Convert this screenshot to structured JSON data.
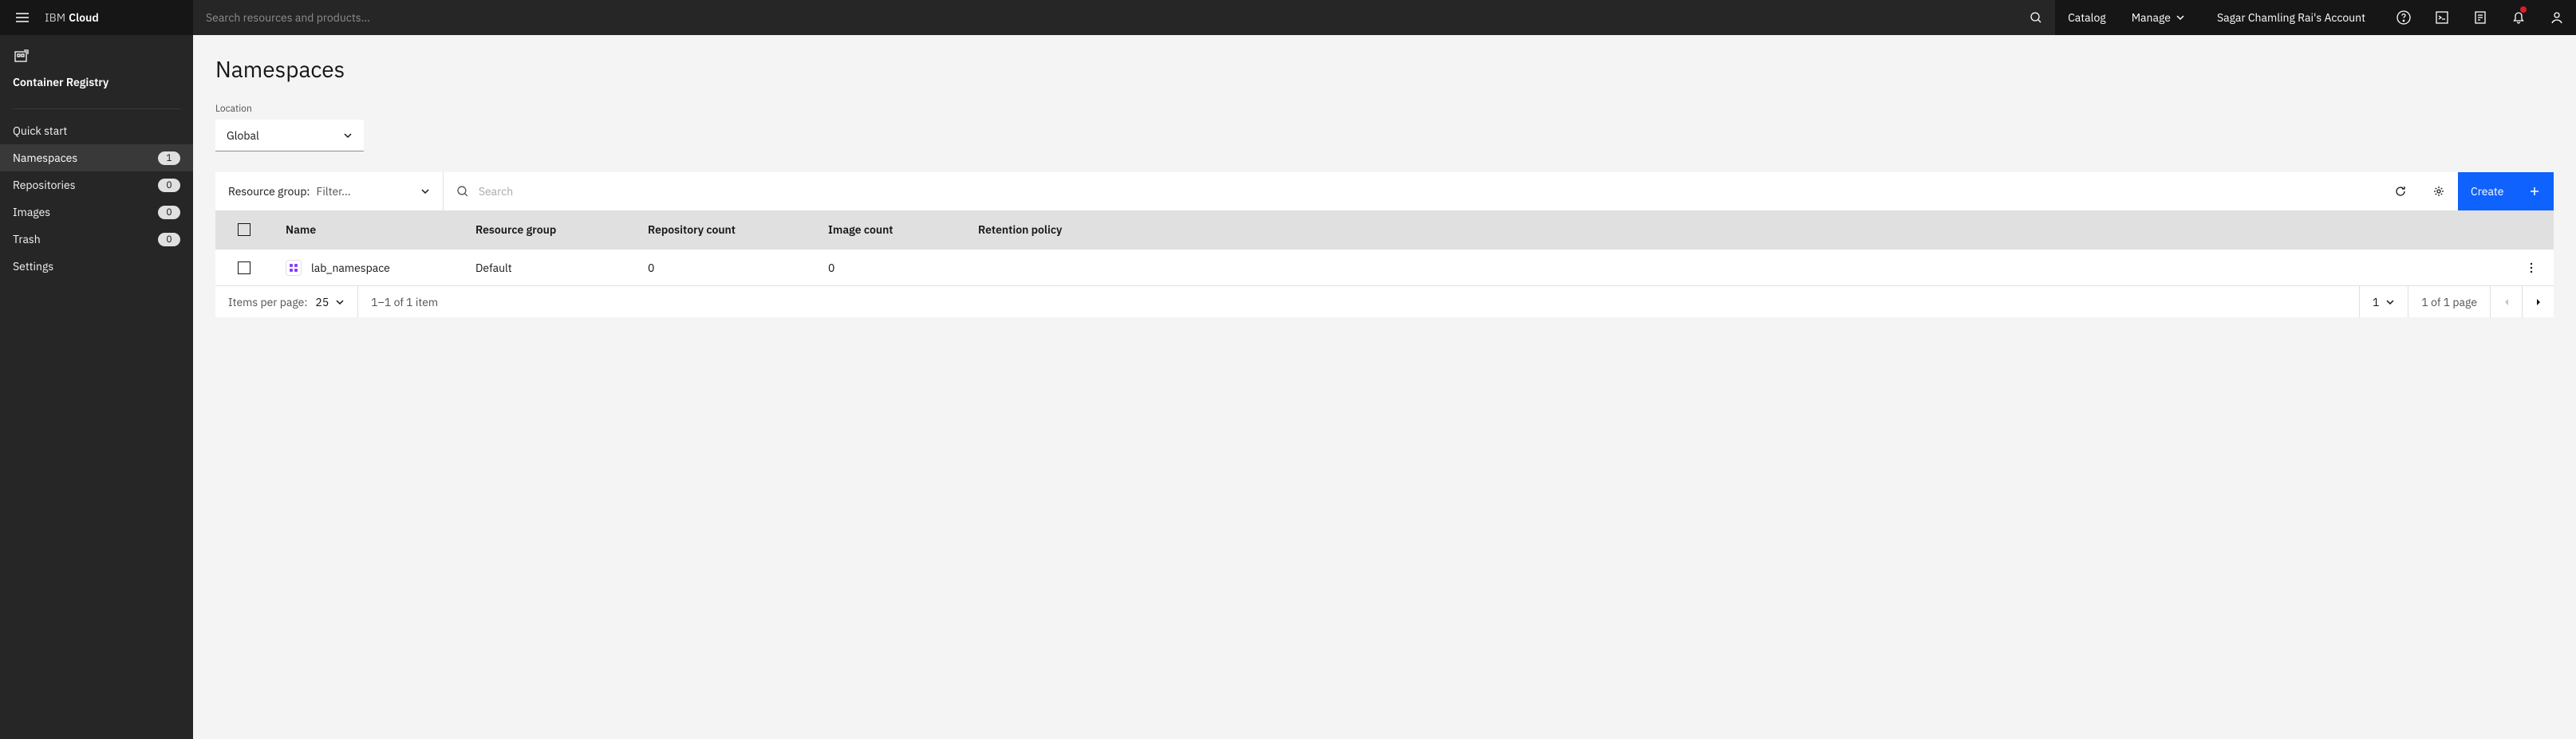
{
  "header": {
    "brand_prefix": "IBM",
    "brand_name": "Cloud",
    "search_placeholder": "Search resources and products...",
    "catalog": "Catalog",
    "manage": "Manage",
    "account": "Sagar Chamling Rai's Account"
  },
  "sidebar": {
    "title": "Container Registry",
    "items": [
      {
        "label": "Quick start"
      },
      {
        "label": "Namespaces",
        "count": "1",
        "active": true
      },
      {
        "label": "Repositories",
        "count": "0"
      },
      {
        "label": "Images",
        "count": "0"
      },
      {
        "label": "Trash",
        "count": "0"
      },
      {
        "label": "Settings"
      }
    ]
  },
  "page": {
    "title": "Namespaces",
    "location_label": "Location",
    "location_value": "Global"
  },
  "toolbar": {
    "resource_group_label": "Resource group:",
    "resource_group_filter": "Filter...",
    "search_placeholder": "Search",
    "create_label": "Create"
  },
  "table": {
    "columns": {
      "name": "Name",
      "resource_group": "Resource group",
      "repo_count": "Repository count",
      "image_count": "Image count",
      "retention": "Retention policy"
    },
    "rows": [
      {
        "name": "lab_namespace",
        "resource_group": "Default",
        "repo_count": "0",
        "image_count": "0",
        "retention": ""
      }
    ]
  },
  "pagination": {
    "items_per_page_label": "Items per page:",
    "page_size": "25",
    "range_text": "1–1 of 1 item",
    "page_current": "1",
    "page_of_text": "1 of 1 page"
  }
}
